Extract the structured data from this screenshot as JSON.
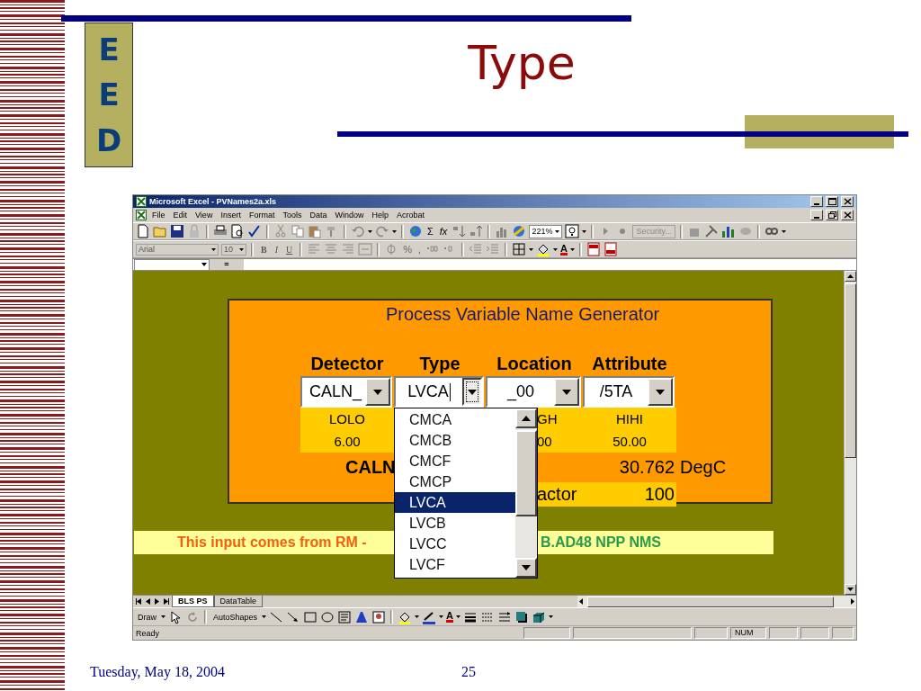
{
  "slide": {
    "logo_letters": [
      "E",
      "E",
      "D"
    ],
    "title": "Type",
    "footer_date": "Tuesday, May 18, 2004",
    "page_number": "25"
  },
  "excel": {
    "title": "Microsoft Excel - PVNames2a.xls",
    "menu": [
      "File",
      "Edit",
      "View",
      "Insert",
      "Format",
      "Tools",
      "Data",
      "Window",
      "Help",
      "Acrobat"
    ],
    "standard_toolbar": {
      "sum_button": "Σ",
      "function_button": "fx",
      "zoom": "221%",
      "security_button": "Security..."
    },
    "formatting_toolbar": {
      "font": "Arial",
      "size": "10",
      "style_buttons": [
        "B",
        "I",
        "U"
      ],
      "number_buttons": [
        "%",
        ","
      ],
      "font_color_button": "A"
    },
    "formula_bar": {
      "equals": "="
    },
    "panel": {
      "title": "Process Variable Name Generator",
      "headers": [
        "Detector",
        "Type",
        "Location",
        "Attribute"
      ],
      "combos": [
        {
          "value": "CALN_",
          "focused": false
        },
        {
          "value": "LVCA",
          "focused": true
        },
        {
          "value": "_00",
          "focused": false
        },
        {
          "value": "/5TA",
          "focused": false
        }
      ],
      "limit_labels": {
        "col_1": "LOLO",
        "col_3": "GH",
        "col_4": "HIHI"
      },
      "limit_values": {
        "col_1": "6.00",
        "col_3": "00",
        "col_4": "50.00"
      },
      "reading_row": {
        "name": "CALN",
        "value": "30.762",
        "unit": "DegC"
      },
      "factor_row": {
        "label": "actor",
        "value": "100"
      }
    },
    "dropdown": {
      "items": [
        {
          "label": "CMCA",
          "selected": false
        },
        {
          "label": "CMCB",
          "selected": false
        },
        {
          "label": "CMCF",
          "selected": false
        },
        {
          "label": "CMCP",
          "selected": false
        },
        {
          "label": "LVCA",
          "selected": true
        },
        {
          "label": "LVCB",
          "selected": false
        },
        {
          "label": "LVCC",
          "selected": false
        },
        {
          "label": "LVCF",
          "selected": false
        }
      ]
    },
    "note": {
      "lead": "This input comes from RM - ",
      "tail": "B.AD48 NPP NMS"
    },
    "sheet_tabs": [
      {
        "label": "BLS PS",
        "selected": true
      },
      {
        "label": "DataTable",
        "selected": false
      }
    ],
    "drawing_toolbar": {
      "draw_button": "Draw",
      "autoshapes_button": "AutoShapes",
      "font_color_button": "A"
    },
    "status_bar": {
      "status": "Ready",
      "num_indicator": "NUM"
    }
  }
}
